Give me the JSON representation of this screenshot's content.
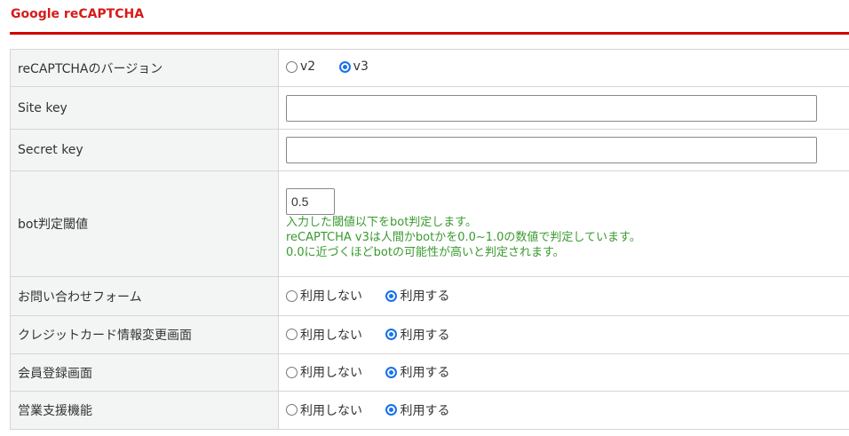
{
  "title": "Google reCAPTCHA",
  "rows": {
    "version": {
      "label": "reCAPTCHAのバージョン",
      "options": [
        "v2",
        "v3"
      ],
      "selected": "v3"
    },
    "site_key": {
      "label": "Site key",
      "value": ""
    },
    "secret_key": {
      "label": "Secret key",
      "value": ""
    },
    "threshold": {
      "label": "bot判定閾値",
      "value": "0.5",
      "help": [
        "入力した閾値以下をbot判定します。",
        "reCAPTCHA v3は人間かbotかを0.0~1.0の数値で判定しています。",
        "0.0に近づくほどbotの可能性が高いと判定されます。"
      ]
    },
    "usage": [
      {
        "label": "お問い合わせフォーム",
        "off": "利用しない",
        "on": "利用する",
        "selected": "on"
      },
      {
        "label": "クレジットカード情報変更画面",
        "off": "利用しない",
        "on": "利用する",
        "selected": "on"
      },
      {
        "label": "会員登録画面",
        "off": "利用しない",
        "on": "利用する",
        "selected": "on"
      },
      {
        "label": "営業支援機能",
        "off": "利用しない",
        "on": "利用する",
        "selected": "on"
      }
    ]
  }
}
